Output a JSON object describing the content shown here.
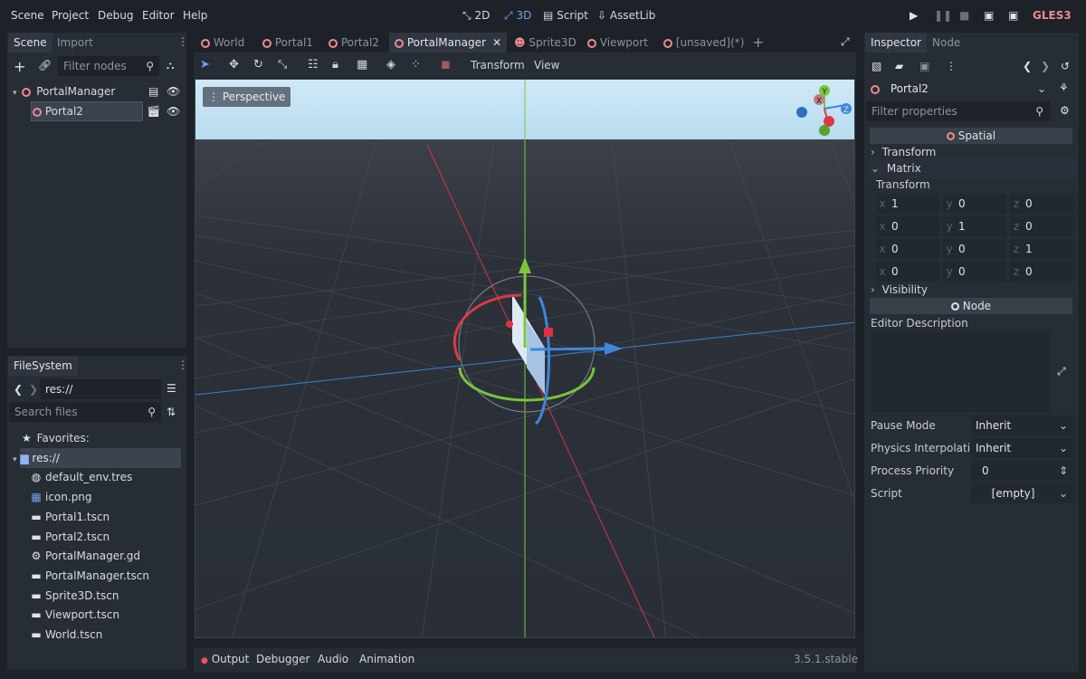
{
  "menu": {
    "scene": "Scene",
    "project": "Project",
    "debug": "Debug",
    "editor": "Editor",
    "help": "Help"
  },
  "workspaces": {
    "w2d": "2D",
    "w3d": "3D",
    "script": "Script",
    "assetlib": "AssetLib"
  },
  "renderer": "GLES3",
  "scene_dock": {
    "tabs": [
      "Scene",
      "Import"
    ],
    "filter_placeholder": "Filter nodes",
    "nodes": [
      "PortalManager",
      "Portal2"
    ]
  },
  "filesystem": {
    "tab": "FileSystem",
    "path": "res://",
    "search_placeholder": "Search files",
    "favorites": "Favorites:",
    "root": "res://",
    "files": [
      "default_env.tres",
      "icon.png",
      "Portal1.tscn",
      "Portal2.tscn",
      "PortalManager.gd",
      "PortalManager.tscn",
      "Sprite3D.tscn",
      "Viewport.tscn",
      "World.tscn"
    ]
  },
  "scene_tabs": [
    "World",
    "Portal1",
    "Portal2",
    "PortalManager",
    "Sprite3D",
    "Viewport",
    "[unsaved](*)"
  ],
  "toolbar": {
    "transform": "Transform",
    "view": "View"
  },
  "viewport": {
    "perspective": "Perspective"
  },
  "gizmo": {
    "y": "Y",
    "x": "X",
    "z": "Z"
  },
  "bottom": {
    "output": "Output",
    "debugger": "Debugger",
    "audio": "Audio",
    "animation": "Animation",
    "version": "3.5.1.stable"
  },
  "inspector": {
    "tabs": [
      "Inspector",
      "Node"
    ],
    "object": "Portal2",
    "filter_placeholder": "Filter properties",
    "spatial": "Spatial",
    "transform": "Transform",
    "matrix": "Matrix",
    "matrix_transform": "Transform",
    "matrix_rows": [
      {
        "x": "1",
        "y": "0",
        "z": "0"
      },
      {
        "x": "0",
        "y": "1",
        "z": "0"
      },
      {
        "x": "0",
        "y": "0",
        "z": "1"
      },
      {
        "x": "0",
        "y": "0",
        "z": "0"
      }
    ],
    "visibility": "Visibility",
    "node": "Node",
    "editor_description": "Editor Description",
    "pause_mode_label": "Pause Mode",
    "pause_mode_value": "Inherit",
    "physics_label": "Physics Interpolatio",
    "physics_value": "Inherit",
    "priority_label": "Process Priority",
    "priority_value": "0",
    "script_label": "Script",
    "script_value": "[empty]"
  },
  "colors": {
    "accent": "#6fa1e8",
    "portal_ring": "#f08a8f",
    "sky": "#c9e6f6",
    "ground": "#2b3038"
  }
}
